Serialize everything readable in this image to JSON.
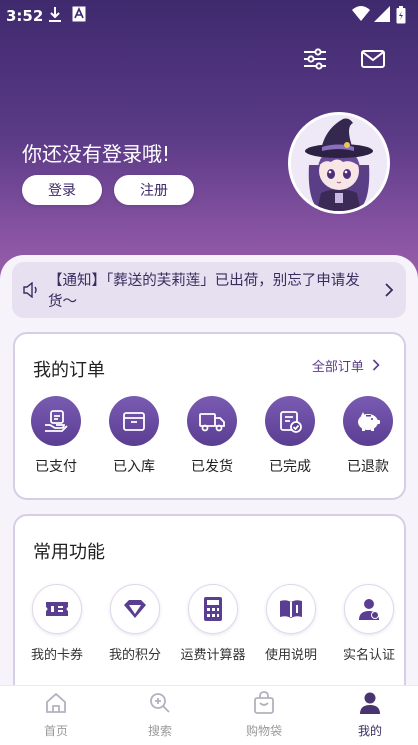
{
  "status_bar": {
    "time": "3:52"
  },
  "header": {
    "greeting": "你还没有登录哦!",
    "login_label": "登录",
    "register_label": "注册"
  },
  "notice": {
    "text": "【通知】「葬送的芙莉莲」已出荷，别忘了申请发货～"
  },
  "orders": {
    "title": "我的订单",
    "all_label": "全部订单",
    "items": [
      {
        "label": "已支付",
        "icon": "paid-icon"
      },
      {
        "label": "已入库",
        "icon": "warehouse-box-icon"
      },
      {
        "label": "已发货",
        "icon": "delivery-truck-icon"
      },
      {
        "label": "已完成",
        "icon": "completed-icon"
      },
      {
        "label": "已退款",
        "icon": "piggy-bank-icon"
      }
    ]
  },
  "tools": {
    "title": "常用功能",
    "items": [
      {
        "label": "我的卡券",
        "icon": "coupon-icon"
      },
      {
        "label": "我的积分",
        "icon": "diamond-icon"
      },
      {
        "label": "运费计算器",
        "icon": "calculator-icon"
      },
      {
        "label": "使用说明",
        "icon": "book-icon"
      },
      {
        "label": "实名认证",
        "icon": "user-verify-icon"
      }
    ]
  },
  "tabbar": {
    "items": [
      {
        "label": "首页",
        "icon": "home-icon"
      },
      {
        "label": "搜索",
        "icon": "search-icon"
      },
      {
        "label": "购物袋",
        "icon": "shopping-bag-icon"
      },
      {
        "label": "我的",
        "icon": "profile-icon"
      }
    ],
    "active_index": 3
  },
  "colors": {
    "accent": "#5a3e92",
    "hero_top": "#3f2a6e",
    "hero_bottom": "#a062ac"
  }
}
